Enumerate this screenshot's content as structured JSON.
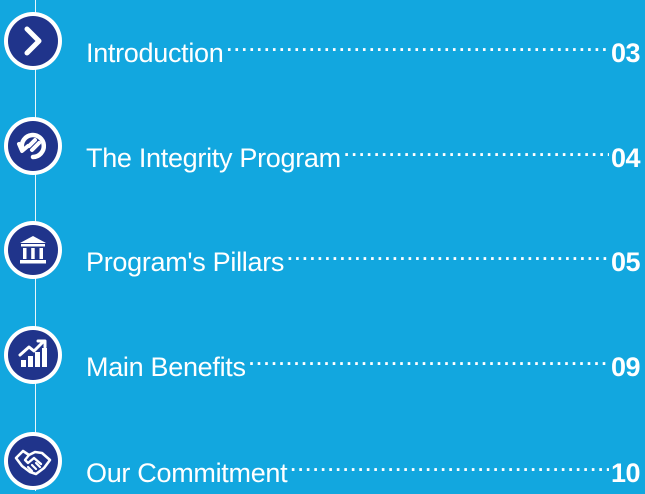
{
  "toc": {
    "entries": [
      {
        "title": "Introduction",
        "page": "03",
        "icon": "chevron-right-icon"
      },
      {
        "title": "The Integrity Program",
        "page": "04",
        "icon": "refresh-icon"
      },
      {
        "title": "Program's Pillars",
        "page": "05",
        "icon": "pillars-icon"
      },
      {
        "title": "Main Benefits",
        "page": "09",
        "icon": "growth-chart-icon"
      },
      {
        "title": "Our Commitment",
        "page": "10",
        "icon": "handshake-icon"
      }
    ]
  },
  "colors": {
    "background": "#12a7df",
    "badge_fill": "#20348b",
    "badge_ring": "#ffffff",
    "text": "#ffffff"
  }
}
